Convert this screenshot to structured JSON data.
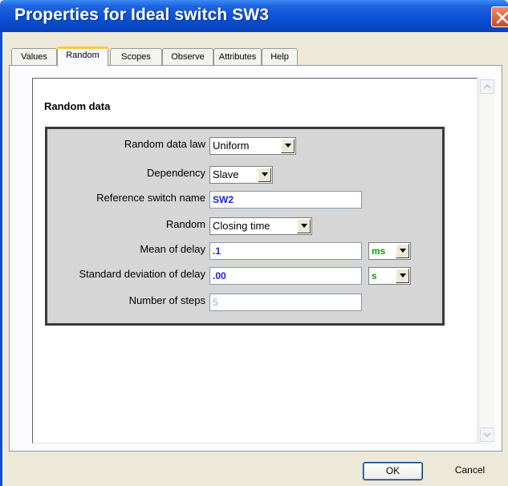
{
  "window": {
    "title": "Properties for Ideal switch SW3"
  },
  "tabs": [
    {
      "label": "Values"
    },
    {
      "label": "Random"
    },
    {
      "label": "Scopes"
    },
    {
      "label": "Observe"
    },
    {
      "label": "Attributes"
    },
    {
      "label": "Help"
    }
  ],
  "active_tab": "Random",
  "panel": {
    "section_title": "Random data",
    "fields": {
      "random_data_law": {
        "label": "Random data law",
        "value": "Uniform"
      },
      "dependency": {
        "label": "Dependency",
        "value": "Slave"
      },
      "reference_switch_name": {
        "label": "Reference switch name",
        "value": "SW2"
      },
      "random": {
        "label": "Random",
        "value": "Closing time"
      },
      "mean_of_delay": {
        "label": "Mean of delay",
        "value": ".1",
        "unit": "ms"
      },
      "std_dev_of_delay": {
        "label": "Standard deviation of delay",
        "value": ".00",
        "unit": "s"
      },
      "number_of_steps": {
        "label": "Number of steps",
        "value": "5"
      }
    }
  },
  "buttons": {
    "ok": "OK",
    "cancel": "Cancel"
  },
  "colors": {
    "titlebar": "#0a4fd4",
    "value_text": "#1a1aff",
    "unit_text": "#119c11",
    "group_bg": "#d6d6d6",
    "dialog_bg": "#ece9d8"
  }
}
